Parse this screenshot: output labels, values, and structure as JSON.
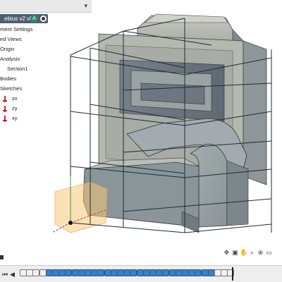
{
  "browser": {
    "doc_title": "ebius v2 v8",
    "items": [
      {
        "label": "ment Settings"
      },
      {
        "label": "ed Views"
      },
      {
        "label": "Origin"
      },
      {
        "label": "Analysis"
      },
      {
        "label": "Section1"
      },
      {
        "label": "Bodies"
      },
      {
        "label": "Sketches"
      },
      {
        "label": "zx"
      },
      {
        "label": "zy"
      },
      {
        "label": "xy"
      }
    ]
  },
  "icons": {
    "collapse": "chevron-down-icon",
    "badge": "component-badge-icon",
    "target": "radio-target-icon",
    "sketch": "sketch-icon"
  },
  "colors": {
    "browser_header": "#4f5f72",
    "badge": "#2f8a68",
    "model": "#8f9a9c",
    "section_plane": "#f5c87a",
    "timeline_feature": "#3d7ec6"
  },
  "timeline": {
    "features": [
      "sketch",
      "sketch",
      "sketch",
      "sketch",
      "feature",
      "feature",
      "feature",
      "feature",
      "feature",
      "feature",
      "feature",
      "feature",
      "feature",
      "feature",
      "feature",
      "feature",
      "feature",
      "feature",
      "feature",
      "feature",
      "feature",
      "feature",
      "feature",
      "feature",
      "feature",
      "feature",
      "feature",
      "feature",
      "feature",
      "feature",
      "sketch",
      "sketch",
      "sketch"
    ]
  }
}
